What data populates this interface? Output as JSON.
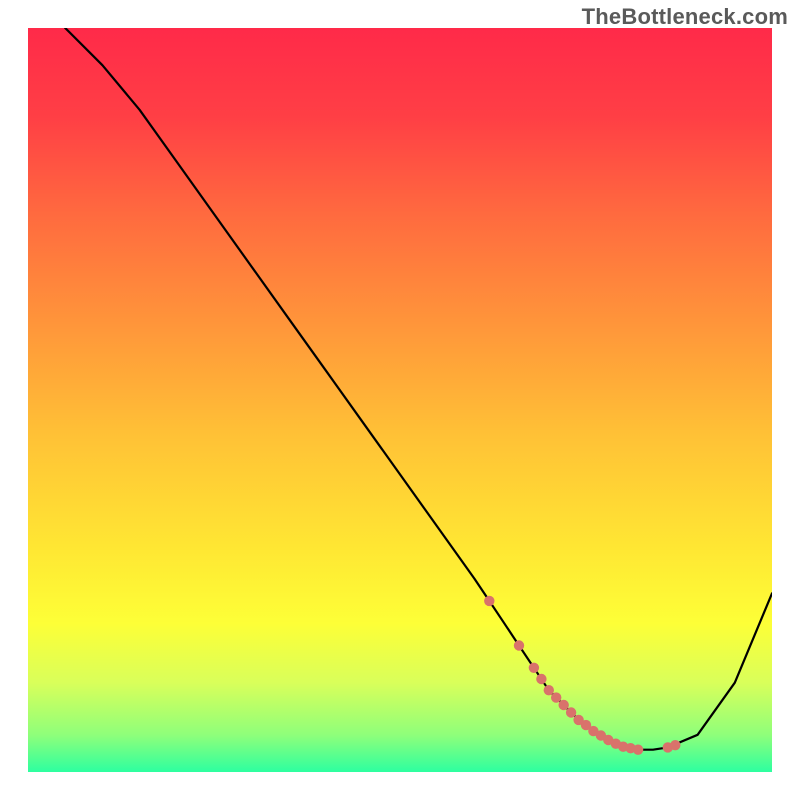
{
  "watermark": "TheBottleneck.com",
  "chart_data": {
    "type": "line",
    "title": "",
    "xlabel": "",
    "ylabel": "",
    "xlim": [
      0,
      100
    ],
    "ylim": [
      0,
      100
    ],
    "legend": false,
    "grid": false,
    "background_gradient": {
      "stops": [
        {
          "offset": 0.0,
          "color": "#ff2a49"
        },
        {
          "offset": 0.12,
          "color": "#ff3f45"
        },
        {
          "offset": 0.25,
          "color": "#ff6a3f"
        },
        {
          "offset": 0.4,
          "color": "#ff963a"
        },
        {
          "offset": 0.55,
          "color": "#ffc236"
        },
        {
          "offset": 0.7,
          "color": "#ffe733"
        },
        {
          "offset": 0.8,
          "color": "#fdff37"
        },
        {
          "offset": 0.88,
          "color": "#d9ff5a"
        },
        {
          "offset": 0.95,
          "color": "#8fff7a"
        },
        {
          "offset": 1.0,
          "color": "#2dffa0"
        }
      ]
    },
    "series": [
      {
        "name": "curve",
        "color": "#000000",
        "x": [
          5,
          10,
          15,
          20,
          25,
          30,
          35,
          40,
          45,
          50,
          55,
          60,
          62,
          64,
          66,
          68,
          70,
          72,
          74,
          76,
          78,
          80,
          82,
          84,
          86,
          90,
          95,
          100
        ],
        "y": [
          100,
          95,
          89,
          82,
          75,
          68,
          61,
          54,
          47,
          40,
          33,
          26,
          23,
          20,
          17,
          14,
          11,
          9,
          7,
          5.5,
          4.3,
          3.4,
          3.0,
          3.0,
          3.3,
          5.0,
          12,
          24
        ]
      },
      {
        "name": "optimal-markers",
        "color": "#d9726b",
        "type": "scatter",
        "marker": "circle",
        "x": [
          62,
          66,
          68,
          69,
          70,
          71,
          72,
          73,
          74,
          75,
          76,
          77,
          78,
          79,
          80,
          81,
          82,
          86,
          87
        ],
        "y": [
          23,
          17,
          14,
          12.5,
          11,
          10,
          9,
          8,
          7,
          6.3,
          5.5,
          4.9,
          4.3,
          3.8,
          3.4,
          3.2,
          3.0,
          3.3,
          3.6
        ]
      }
    ]
  }
}
